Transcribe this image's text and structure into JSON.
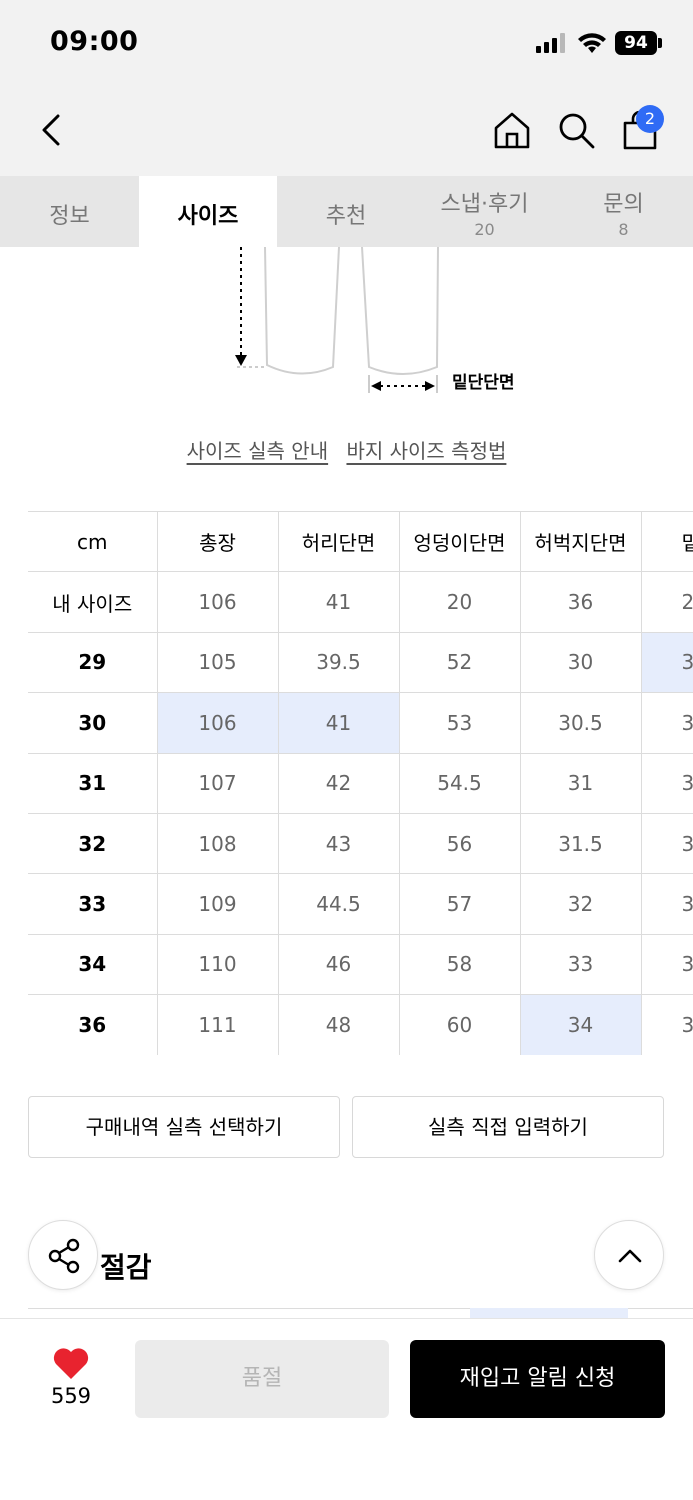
{
  "status_bar": {
    "time": "09:00",
    "battery": "94"
  },
  "nav": {
    "cart_count": "2"
  },
  "tabs": [
    {
      "label": "정보",
      "count": ""
    },
    {
      "label": "사이즈",
      "count": ""
    },
    {
      "label": "추천",
      "count": ""
    },
    {
      "label": "스냅·후기",
      "count": "20"
    },
    {
      "label": "문의",
      "count": "8"
    }
  ],
  "diagram": {
    "hem_label": "밑단단면"
  },
  "links": {
    "size_guide": "사이즈 실측 안내",
    "measure_method": "바지 사이즈 측정법"
  },
  "size_table": {
    "headers": [
      "cm",
      "총장",
      "허리단면",
      "엉덩이단면",
      "허벅지단면",
      "밑"
    ],
    "rows": [
      {
        "label": "내 사이즈",
        "values": [
          "106",
          "41",
          "20",
          "36",
          "2"
        ]
      },
      {
        "label": "29",
        "values": [
          "105",
          "39.5",
          "52",
          "30",
          "3"
        ]
      },
      {
        "label": "30",
        "values": [
          "106",
          "41",
          "53",
          "30.5",
          "3"
        ]
      },
      {
        "label": "31",
        "values": [
          "107",
          "42",
          "54.5",
          "31",
          "3"
        ]
      },
      {
        "label": "32",
        "values": [
          "108",
          "43",
          "56",
          "31.5",
          "3"
        ]
      },
      {
        "label": "33",
        "values": [
          "109",
          "44.5",
          "57",
          "32",
          "3"
        ]
      },
      {
        "label": "34",
        "values": [
          "110",
          "46",
          "58",
          "33",
          "3"
        ]
      },
      {
        "label": "36",
        "values": [
          "111",
          "48",
          "60",
          "34",
          "3"
        ]
      }
    ],
    "highlight_color": "#e6edfc"
  },
  "actions": {
    "select_history": "구매내역 실측 선택하기",
    "manual_input": "실측 직접 입력하기"
  },
  "section": {
    "title": "절감"
  },
  "bottom_bar": {
    "likes": "559",
    "soldout": "품절",
    "restock": "재입고 알림 신청"
  },
  "colors": {
    "accent": "#2f6bf5",
    "heart": "#e8232f",
    "primary_button": "#000000"
  }
}
